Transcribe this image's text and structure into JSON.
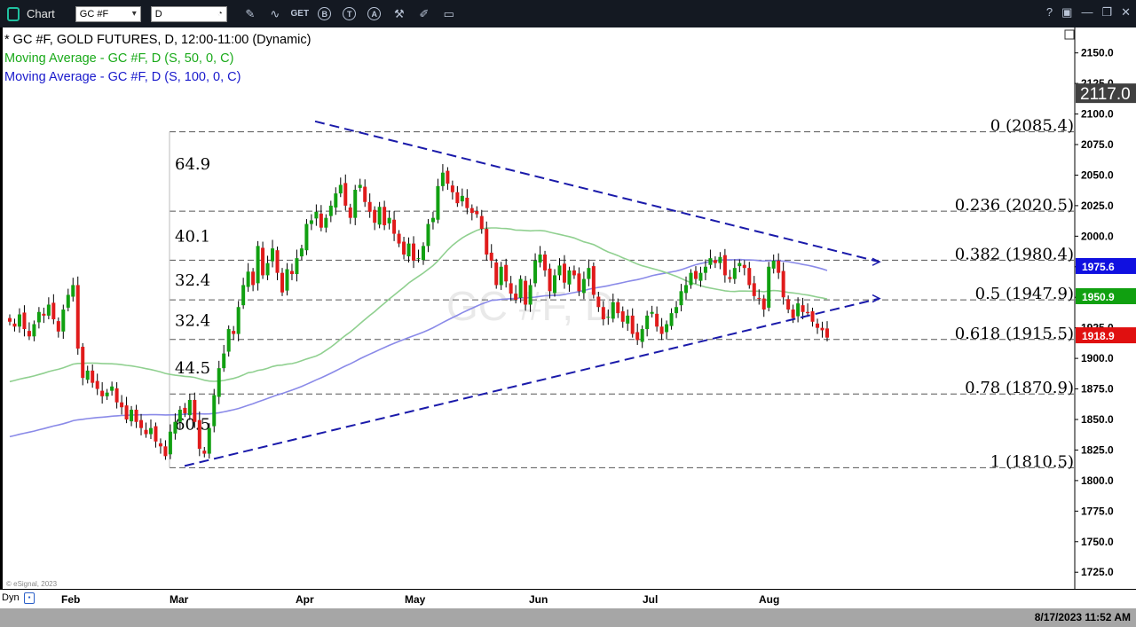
{
  "window": {
    "title": "Chart",
    "symbol_value": "GC #F",
    "interval_value": "D",
    "toolbar_icons": [
      "draw-pencil-icon",
      "study-icon",
      "get-icon",
      "b-icon",
      "t-icon",
      "a-icon",
      "tools-icon",
      "edit-icon",
      "comment-icon"
    ],
    "toolbar_icon_labels": [
      "",
      "",
      "GET",
      "B",
      "T",
      "A",
      "",
      "",
      ""
    ],
    "window_controls": [
      "help-icon",
      "restore-icon",
      "minimize-icon",
      "maximize-icon",
      "close-icon"
    ],
    "window_control_labels": [
      "?",
      "",
      "—",
      "",
      ""
    ]
  },
  "legend": {
    "main": "* GC #F, GOLD FUTURES, D, 12:00-11:00 (Dynamic)",
    "ma50": "Moving Average - GC #F, D (S, 50, 0, C)",
    "ma100": "Moving Average - GC #F, D (S, 100, 0, C)"
  },
  "watermark": "GC #F, D",
  "copyright": "© eSignal, 2023",
  "bottom": {
    "dyn": "Dyn",
    "lock_icon": "lock-icon"
  },
  "status": {
    "datetime": "8/17/2023 11:52 AM"
  },
  "colors": {
    "up": "#11a011",
    "down": "#e01b1b",
    "ma50": "#90d090",
    "ma100": "#8a8ae8",
    "trend": "#1a1aaa",
    "fib": "#555555",
    "badge_current": "#404040",
    "badge_blue": "#1010e0",
    "badge_green": "#10a010",
    "badge_red": "#e01010"
  },
  "chart_data": {
    "type": "candlestick",
    "ylim": [
      1715,
      2165
    ],
    "y_ticks": [
      "2150.0",
      "2125.0",
      "2100.0",
      "2075.0",
      "2050.0",
      "2025.0",
      "2000.0",
      "1975.0",
      "1950.0",
      "1925.0",
      "1900.0",
      "1875.0",
      "1850.0",
      "1825.0",
      "1800.0",
      "1775.0",
      "1750.0",
      "1725.0"
    ],
    "x_labels": [
      "Feb",
      "Mar",
      "Apr",
      "May",
      "Jun",
      "Jul",
      "Aug"
    ],
    "price_badges": [
      {
        "label": "2117.0",
        "value": 2117,
        "kind": "current"
      },
      {
        "label": "1975.6",
        "value": 1975.6,
        "kind": "blue"
      },
      {
        "label": "1950.9",
        "value": 1950.9,
        "kind": "green"
      },
      {
        "label": "1918.9",
        "value": 1918.9,
        "kind": "red"
      }
    ],
    "fib_levels": [
      {
        "label": "0 (2085.4)",
        "value": 2085.4
      },
      {
        "label": "0.236 (2020.5)",
        "value": 2020.5
      },
      {
        "label": "0.382 (1980.4)",
        "value": 1980.4
      },
      {
        "label": "0.5 (1947.9)",
        "value": 1947.9
      },
      {
        "label": "0.618 (1915.5)",
        "value": 1915.5
      },
      {
        "label": "0.78 (1870.9)",
        "value": 1870.9
      },
      {
        "label": "1 (1810.5)",
        "value": 1810.5
      }
    ],
    "side_labels": [
      {
        "text": "64.9",
        "value": 2059
      },
      {
        "text": "40.1",
        "value": 2000
      },
      {
        "text": "32.4",
        "value": 1964
      },
      {
        "text": "32.4",
        "value": 1931
      },
      {
        "text": "44.5",
        "value": 1892
      },
      {
        "text": "60.5",
        "value": 1846
      }
    ],
    "trendlines": [
      {
        "name": "upper",
        "from": [
          0,
          2094
        ],
        "to": [
          1,
          1979
        ]
      },
      {
        "name": "lower",
        "from": [
          0,
          1812
        ],
        "to": [
          1,
          1949
        ]
      }
    ],
    "closes": [
      1930,
      1926,
      1936,
      1924,
      1918,
      1928,
      1938,
      1935,
      1944,
      1932,
      1922,
      1940,
      1952,
      1960,
      1908,
      1884,
      1890,
      1880,
      1875,
      1869,
      1872,
      1877,
      1864,
      1860,
      1850,
      1858,
      1848,
      1843,
      1838,
      1843,
      1832,
      1828,
      1820,
      1840,
      1848,
      1858,
      1855,
      1866,
      1848,
      1826,
      1822,
      1843,
      1870,
      1892,
      1904,
      1924,
      1920,
      1942,
      1960,
      1971,
      1960,
      1992,
      1968,
      1978,
      1990,
      1970,
      1954,
      1973,
      1969,
      1982,
      1990,
      2010,
      2013,
      2020,
      2007,
      2015,
      2025,
      2035,
      2042,
      2025,
      2015,
      2038,
      2042,
      2028,
      2020,
      2011,
      2024,
      2009,
      2015,
      2002,
      1994,
      1985,
      1994,
      1980,
      1982,
      1992,
      2010,
      2015,
      2041,
      2052,
      2043,
      2036,
      2027,
      2033,
      2023,
      2019,
      2018,
      2006,
      1985,
      1980,
      1960,
      1975,
      1963,
      1953,
      1948,
      1965,
      1944,
      1960,
      1980,
      1985,
      1972,
      1955,
      1968,
      1976,
      1962,
      1972,
      1968,
      1955,
      1965,
      1974,
      1952,
      1942,
      1932,
      1934,
      1946,
      1937,
      1930,
      1935,
      1920,
      1915,
      1924,
      1935,
      1938,
      1926,
      1920,
      1928,
      1937,
      1942,
      1955,
      1960,
      1970,
      1965,
      1970,
      1975,
      1982,
      1978,
      1983,
      1968,
      1965,
      1974,
      1978,
      1974,
      1960,
      1951,
      1949,
      1940,
      1975,
      1980,
      1970,
      1950,
      1940,
      1933,
      1945,
      1938,
      1937,
      1930,
      1925,
      1923,
      1917
    ]
  }
}
